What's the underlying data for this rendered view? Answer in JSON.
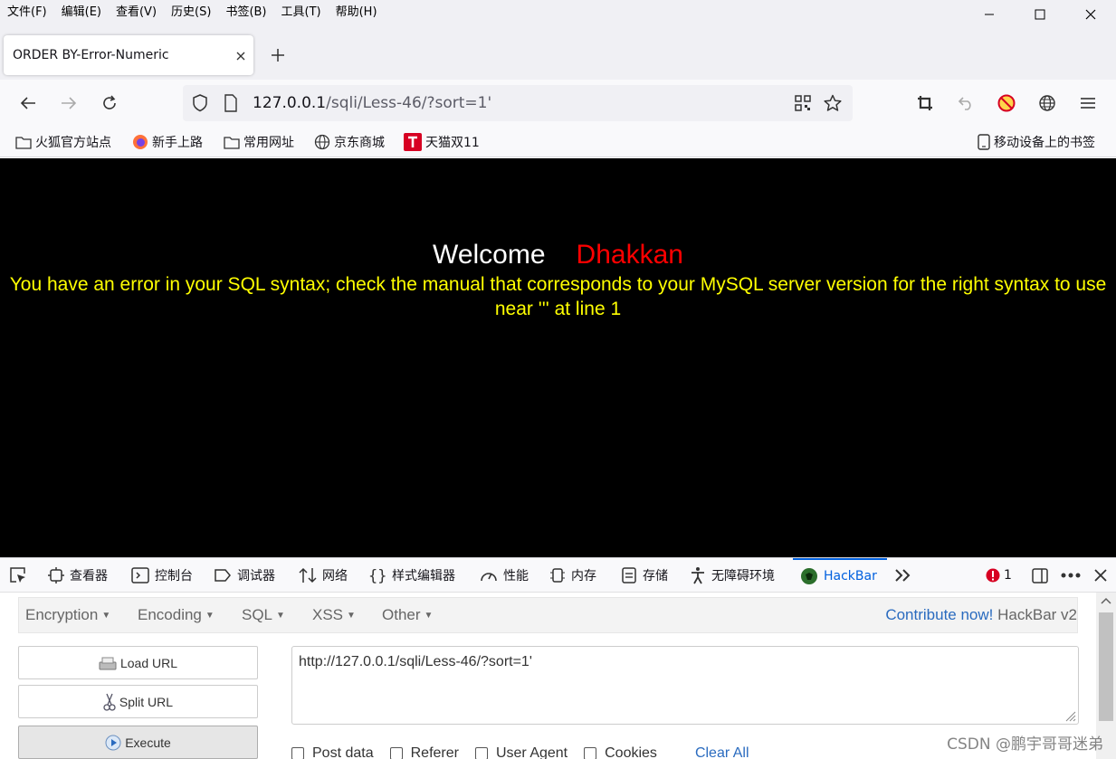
{
  "menubar": {
    "items": [
      "文件(F)",
      "编辑(E)",
      "查看(V)",
      "历史(S)",
      "书签(B)",
      "工具(T)",
      "帮助(H)"
    ]
  },
  "tab": {
    "title": "ORDER BY-Error-Numeric"
  },
  "navbar": {
    "url_host": "127.0.0.1",
    "url_path": "/sqli/Less-46/?sort=1'"
  },
  "bookmarks": {
    "items": [
      "火狐官方站点",
      "新手上路",
      "常用网址",
      "京东商城",
      "天猫双11"
    ],
    "mobile": "移动设备上的书签"
  },
  "page": {
    "welcome": "Welcome",
    "name": "Dhakkan",
    "error": "You have an error in your SQL syntax; check the manual that corresponds to your MySQL server version for the right syntax to use near ''' at line 1",
    "colors": {
      "background": "#000000",
      "welcome": "#ffffff",
      "name": "#ff0000",
      "error": "#ffff00"
    }
  },
  "devtools": {
    "tabs": [
      "查看器",
      "控制台",
      "调试器",
      "网络",
      "样式编辑器",
      "性能",
      "内存",
      "存储",
      "无障碍环境",
      "HackBar"
    ],
    "active_tab": "HackBar",
    "error_count": "1"
  },
  "hackbar": {
    "menu": [
      "Encryption",
      "Encoding",
      "SQL",
      "XSS",
      "Other"
    ],
    "contribute": "Contribute now!",
    "version": "HackBar v2",
    "load_url": "Load URL",
    "split_url": "Split URL",
    "execute": "Execute",
    "url_value": "http://127.0.0.1/sqli/Less-46/?sort=1'",
    "options": [
      "Post data",
      "Referer",
      "User Agent",
      "Cookies"
    ],
    "clear_all": "Clear All"
  },
  "watermark": "CSDN @鹏宇哥哥迷弟"
}
